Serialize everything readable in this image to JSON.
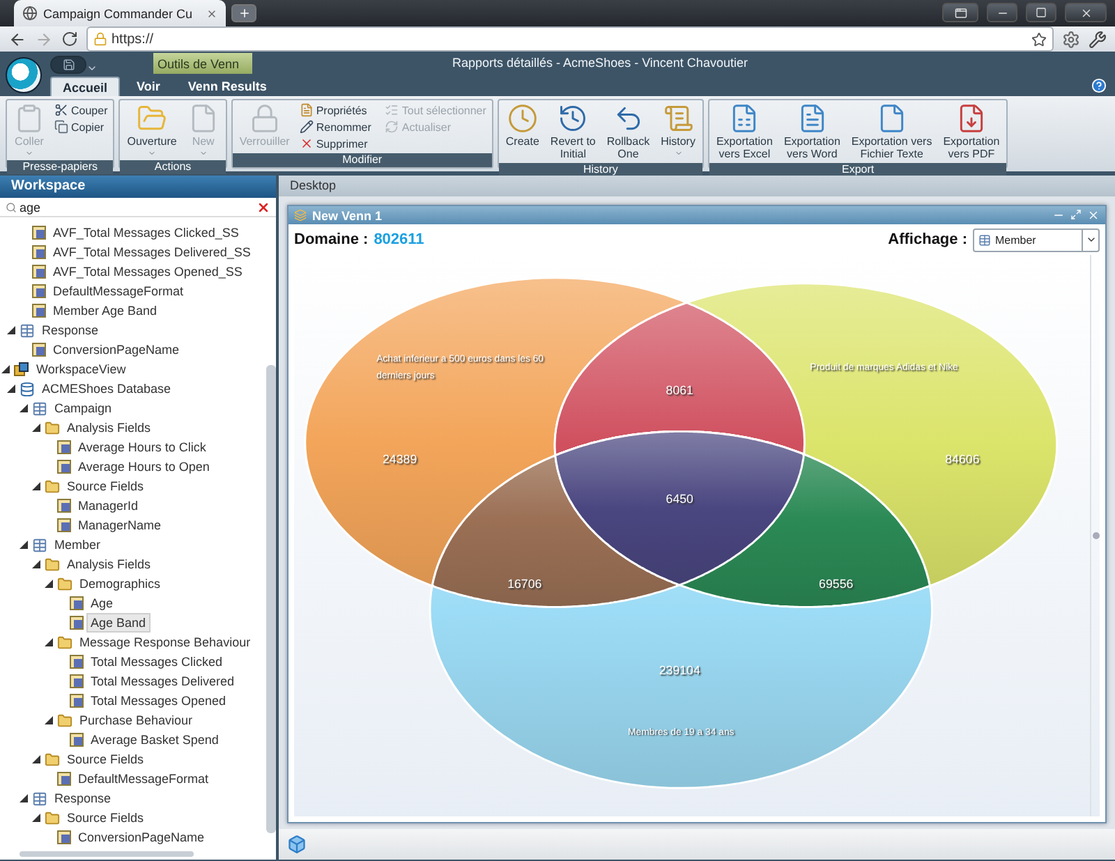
{
  "browser": {
    "tab_title": "Campaign Commander Cu",
    "url": "https://"
  },
  "app": {
    "context_tab": "Outils de Venn",
    "title": "Rapports détaillés - AcmeShoes - Vincent Chavoutier"
  },
  "ribbon_tabs": [
    {
      "label": "Accueil",
      "selected": true
    },
    {
      "label": "Voir",
      "selected": false
    },
    {
      "label": "Venn Results",
      "selected": false
    }
  ],
  "ribbon_groups": [
    {
      "title": "Presse-papiers",
      "buttons": [
        {
          "label": "Coller",
          "kind": "large",
          "disabled": true,
          "dropdown": true
        },
        {
          "label": "Couper",
          "kind": "small",
          "disabled": false
        },
        {
          "label": "Copier",
          "kind": "small",
          "disabled": false
        }
      ]
    },
    {
      "title": "Actions",
      "buttons": [
        {
          "label": "Ouverture",
          "kind": "large",
          "disabled": false,
          "dropdown": true
        },
        {
          "label": "New",
          "kind": "large",
          "disabled": true,
          "dropdown": true
        }
      ]
    },
    {
      "title": "Modifier",
      "buttons": [
        {
          "label": "Verrouiller",
          "kind": "large",
          "disabled": true
        },
        {
          "label": "Propriétés",
          "kind": "small",
          "disabled": false
        },
        {
          "label": "Renommer",
          "kind": "small",
          "disabled": false
        },
        {
          "label": "Supprimer",
          "kind": "small",
          "disabled": false
        },
        {
          "label": "Tout sélectionner",
          "kind": "small",
          "disabled": true
        },
        {
          "label": "Actualiser",
          "kind": "small",
          "disabled": true
        }
      ]
    },
    {
      "title": "History",
      "buttons": [
        {
          "label": "Create",
          "kind": "large",
          "disabled": false
        },
        {
          "label": "Revert to\nInitial",
          "kind": "large",
          "disabled": false
        },
        {
          "label": "Rollback\nOne",
          "kind": "large",
          "disabled": false
        },
        {
          "label": "History",
          "kind": "large",
          "disabled": false,
          "dropdown": true
        }
      ]
    },
    {
      "title": "Export",
      "buttons": [
        {
          "label": "Exportation\nvers Excel",
          "kind": "large",
          "disabled": false
        },
        {
          "label": "Exportation\nvers Word",
          "kind": "large",
          "disabled": false
        },
        {
          "label": "Exportation vers\nFichier Texte",
          "kind": "large",
          "disabled": false
        },
        {
          "label": "Exportation\nvers PDF",
          "kind": "large",
          "disabled": false
        }
      ]
    }
  ],
  "workspace": {
    "title": "Workspace",
    "search": "age",
    "tree": [
      {
        "children": [
          {
            "children": [
              {
                "label": "AVF_Total Messages Clicked_SS",
                "kind": "field",
                "selected": false
              },
              {
                "label": "AVF_Total Messages Delivered_SS",
                "kind": "field",
                "selected": false
              },
              {
                "label": "AVF_Total Messages Opened_SS",
                "kind": "field",
                "selected": false
              },
              {
                "label": "DefaultMessageFormat",
                "kind": "field",
                "selected": false
              },
              {
                "label": "Member Age Band",
                "kind": "field",
                "selected": false
              }
            ]
          },
          {
            "label": "Response",
            "kind": "table",
            "selected": false,
            "expanded": true,
            "children": [
              {
                "label": "ConversionPageName",
                "kind": "field",
                "selected": false
              }
            ]
          }
        ]
      },
      {
        "label": "WorkspaceView",
        "kind": "view",
        "selected": false,
        "expanded": true,
        "children": [
          {
            "label": "ACMEShoes Database",
            "kind": "database",
            "selected": false,
            "expanded": true,
            "children": [
              {
                "label": "Campaign",
                "kind": "table",
                "selected": false,
                "expanded": true,
                "children": [
                  {
                    "label": "Analysis Fields",
                    "kind": "folder",
                    "selected": false,
                    "expanded": true,
                    "children": [
                      {
                        "label": "Average Hours to Click",
                        "kind": "field",
                        "selected": false
                      },
                      {
                        "label": "Average Hours to Open",
                        "kind": "field",
                        "selected": false
                      }
                    ]
                  },
                  {
                    "label": "Source Fields",
                    "kind": "folder",
                    "selected": false,
                    "expanded": true,
                    "children": [
                      {
                        "label": "ManagerId",
                        "kind": "field",
                        "selected": false
                      },
                      {
                        "label": "ManagerName",
                        "kind": "field",
                        "selected": false
                      }
                    ]
                  }
                ]
              },
              {
                "label": "Member",
                "kind": "table",
                "selected": false,
                "expanded": true,
                "children": [
                  {
                    "label": "Analysis Fields",
                    "kind": "folder",
                    "selected": false,
                    "expanded": true,
                    "children": [
                      {
                        "label": "Demographics",
                        "kind": "folder",
                        "selected": false,
                        "expanded": true,
                        "children": [
                          {
                            "label": "Age",
                            "kind": "field",
                            "selected": false
                          },
                          {
                            "label": "Age Band",
                            "kind": "field",
                            "selected": true
                          }
                        ]
                      },
                      {
                        "label": "Message Response Behaviour",
                        "kind": "folder",
                        "selected": false,
                        "expanded": true,
                        "children": [
                          {
                            "label": "Total Messages Clicked",
                            "kind": "field",
                            "selected": false
                          },
                          {
                            "label": "Total Messages Delivered",
                            "kind": "field",
                            "selected": false
                          },
                          {
                            "label": "Total Messages Opened",
                            "kind": "field",
                            "selected": false
                          }
                        ]
                      },
                      {
                        "label": "Purchase Behaviour",
                        "kind": "folder",
                        "selected": false,
                        "expanded": true,
                        "children": [
                          {
                            "label": "Average Basket Spend",
                            "kind": "field",
                            "selected": false
                          }
                        ]
                      }
                    ]
                  },
                  {
                    "label": "Source Fields",
                    "kind": "folder",
                    "selected": false,
                    "expanded": true,
                    "children": [
                      {
                        "label": "DefaultMessageFormat",
                        "kind": "field",
                        "selected": false
                      }
                    ]
                  }
                ]
              },
              {
                "label": "Response",
                "kind": "table",
                "selected": false,
                "expanded": true,
                "children": [
                  {
                    "label": "Source Fields",
                    "kind": "folder",
                    "selected": false,
                    "expanded": true,
                    "children": [
                      {
                        "label": "ConversionPageName",
                        "kind": "field",
                        "selected": false
                      }
                    ]
                  }
                ]
              }
            ]
          }
        ]
      }
    ]
  },
  "desktop": {
    "title": "Desktop",
    "window": {
      "title": "New Venn 1",
      "domain_label": "Domaine :",
      "domain_value": "802611",
      "display_label": "Affichage :",
      "display_value": "Member",
      "venn": {
        "regions": [
          {
            "kind": "left",
            "value": "24389",
            "label": "Achat inferieur a 500 euros dans les 60 derniers jours"
          },
          {
            "kind": "right",
            "value": "84606",
            "label": "Produit de marques Adidas et Nike"
          },
          {
            "kind": "left_right",
            "value": "8061"
          },
          {
            "kind": "bottom",
            "value": "239104",
            "label": "Membres de 19 a 34 ans"
          },
          {
            "kind": "left_bottom",
            "value": "16706"
          },
          {
            "kind": "right_bottom",
            "value": "69556"
          },
          {
            "kind": "all",
            "value": "6450"
          }
        ]
      }
    }
  }
}
